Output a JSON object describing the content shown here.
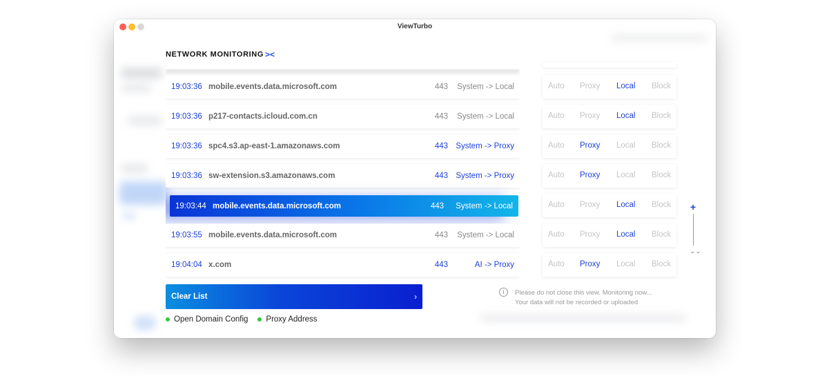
{
  "window": {
    "title": "ViewTurbo"
  },
  "header": {
    "title": "NETWORK MONITORING",
    "icon": "collapse-icon"
  },
  "connections": [
    {
      "time": "19:03:36",
      "domain": "mobile.events.data.microsoft.com",
      "port": "443",
      "route": "System -> Local",
      "mode": "Local"
    },
    {
      "time": "19:03:36",
      "domain": "p217-contacts.icloud.com.cn",
      "port": "443",
      "route": "System -> Local",
      "mode": "Local"
    },
    {
      "time": "19:03:36",
      "domain": "spc4.s3.ap-east-1.amazonaws.com",
      "port": "443",
      "route": "System -> Proxy",
      "mode": "Proxy"
    },
    {
      "time": "19:03:36",
      "domain": "sw-extension.s3.amazonaws.com",
      "port": "443",
      "route": "System -> Proxy",
      "mode": "Proxy"
    },
    {
      "time": "19:03:44",
      "domain": "mobile.events.data.microsoft.com",
      "port": "443",
      "route": "System -> Local",
      "mode": "Local",
      "selected": true
    },
    {
      "time": "19:03:55",
      "domain": "mobile.events.data.microsoft.com",
      "port": "443",
      "route": "System -> Local",
      "mode": "Local"
    },
    {
      "time": "19:04:04",
      "domain": "x.com",
      "port": "443",
      "route": "AI -> Proxy",
      "mode": "Proxy"
    }
  ],
  "mode_labels": {
    "auto": "Auto",
    "proxy": "Proxy",
    "local": "Local",
    "block": "Block"
  },
  "actions": {
    "clear_list": "Clear List",
    "chevron": "›",
    "open_domain_config": "Open Domain Config",
    "proxy_address": "Proxy Address"
  },
  "notice": {
    "line1": "Please do not close this view. Monitoring now...",
    "line2": "Your data will not be recorded or uploaded",
    "icon": "info-icon"
  },
  "side_controls": {
    "plus": "+",
    "down": "⌄"
  },
  "colors": {
    "accent": "#1b3fd8",
    "status_dot": "#2ec63c"
  }
}
